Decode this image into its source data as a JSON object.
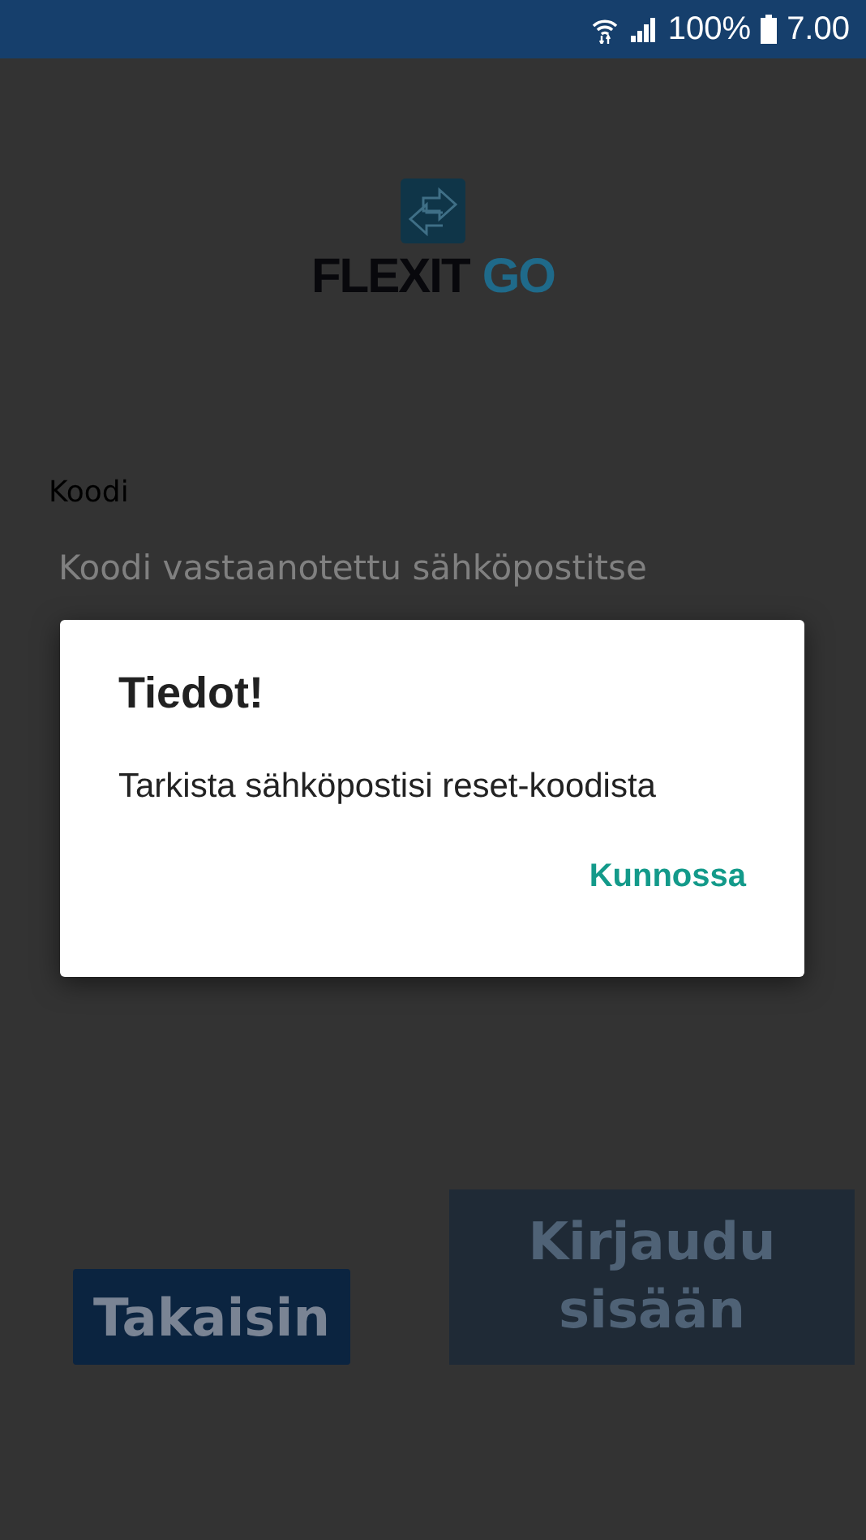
{
  "status_bar": {
    "battery": "100%",
    "time": "7.00"
  },
  "logo": {
    "word1": "FLEXIT",
    "word2": "GO"
  },
  "form": {
    "fields": [
      {
        "label": "Koodi",
        "placeholder": "Koodi vastaanotettu sähköpostitse"
      }
    ]
  },
  "buttons": [
    {
      "label": "Takaisin",
      "kind": "secondary"
    },
    {
      "label": "Kirjaudu sisään",
      "kind": "primary"
    }
  ],
  "dialog": {
    "title": "Tiedot!",
    "message": "Tarkista sähköpostisi reset-koodista",
    "action": "Kunnossa"
  }
}
